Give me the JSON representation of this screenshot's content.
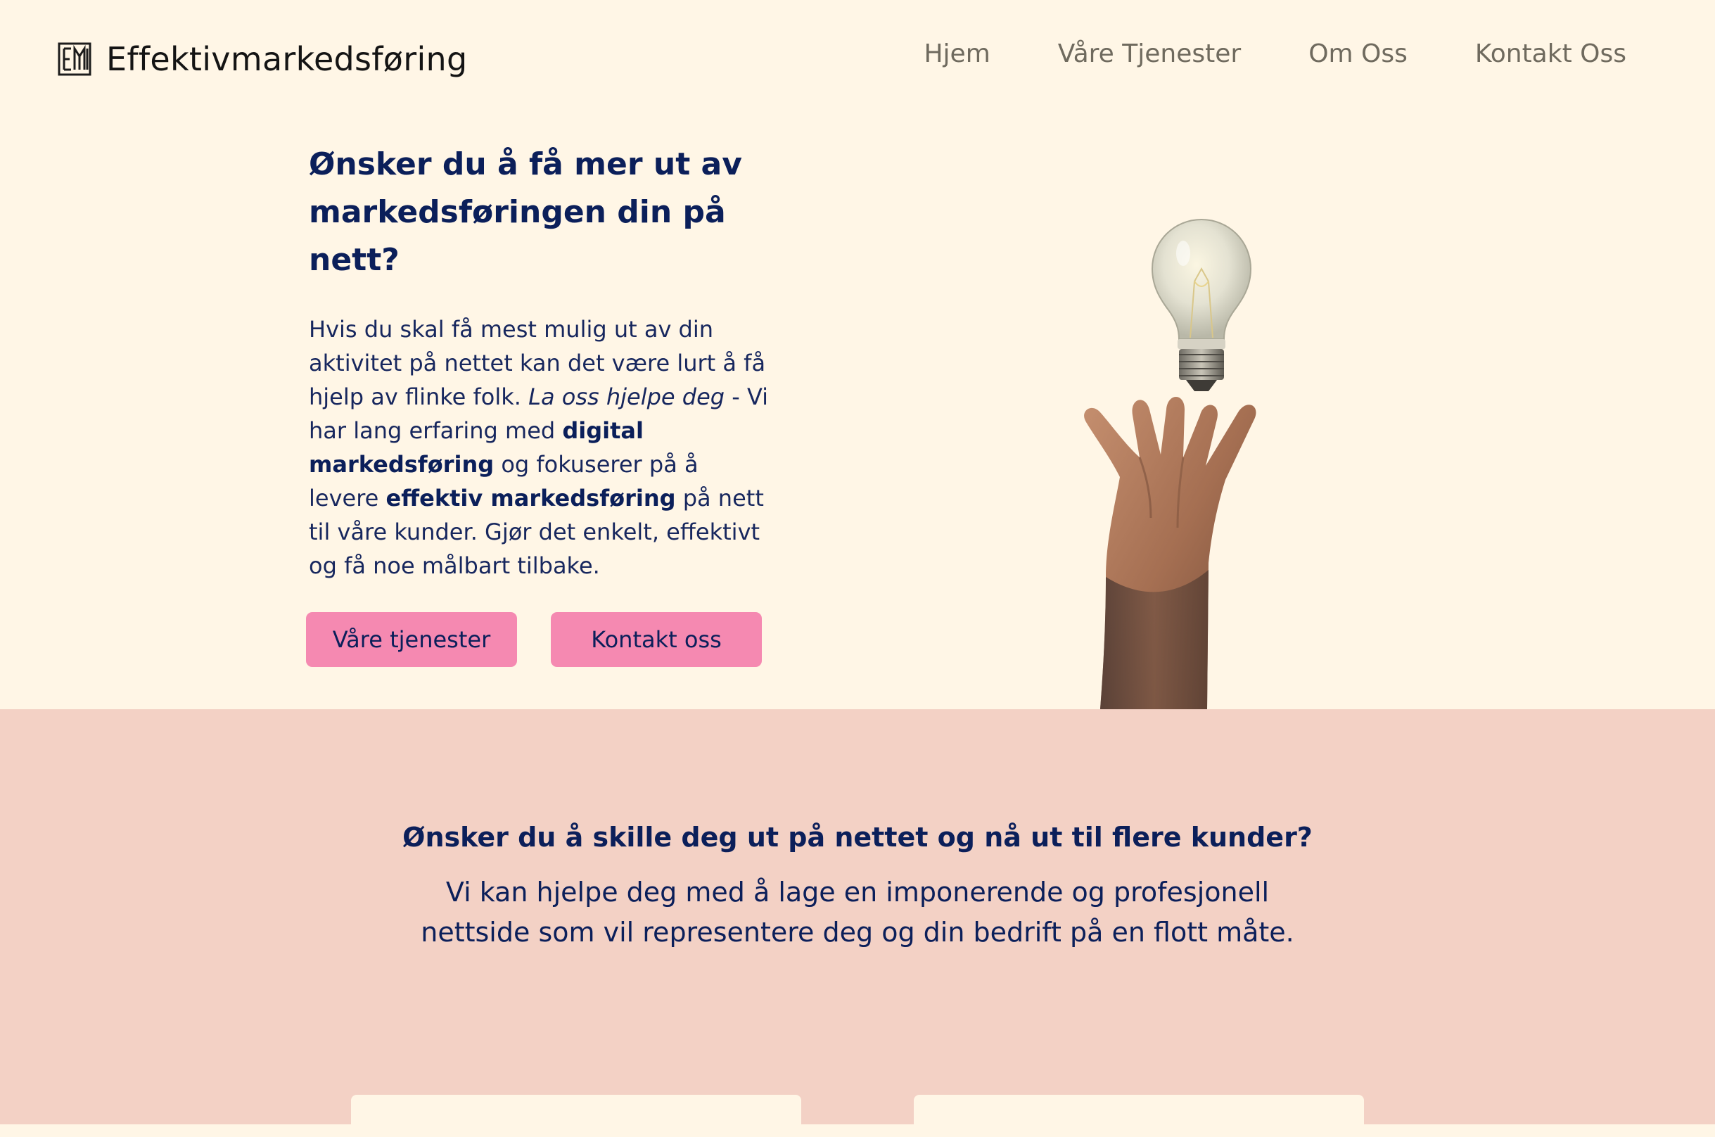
{
  "header": {
    "brand_name": "Effektivmarkedsføring",
    "logo_icon": "em-monogram-icon",
    "nav": [
      {
        "label": "Hjem"
      },
      {
        "label": "Våre Tjenester"
      },
      {
        "label": "Om Oss"
      },
      {
        "label": "Kontakt Oss"
      }
    ]
  },
  "hero": {
    "title": "Ønsker du å få mer ut av markedsføringen din på nett?",
    "body": {
      "part1": "Hvis du skal få mest mulig ut av din aktivitet på nettet kan det være lurt å få hjelp av flinke folk. ",
      "italic": "La oss hjelpe deg",
      "part2": " - Vi har lang erfaring med ",
      "bold1": "digital markedsføring",
      "part3": " og fokuserer på å levere ",
      "bold2": "effektiv markedsføring",
      "part4": " på nett til våre kunder. Gjør det enkelt, effektivt og få noe målbart tilbake."
    },
    "buttons": {
      "services": "Våre tjenester",
      "contact": "Kontakt oss"
    },
    "illustration": "lightbulb-and-hand-image"
  },
  "section2": {
    "title": "Ønsker du å skille deg ut på nettet og nå ut til flere kunder?",
    "text": "Vi kan hjelpe deg med å lage en imponerende og profesjonell nettside som vil representere deg og din bedrift på en flott måte."
  },
  "colors": {
    "background": "#fff6e6",
    "section2_background": "#f3d1c5",
    "button": "#f589b1",
    "text_dark_blue": "#0b1f5a",
    "nav_text": "#6f6a5e"
  }
}
